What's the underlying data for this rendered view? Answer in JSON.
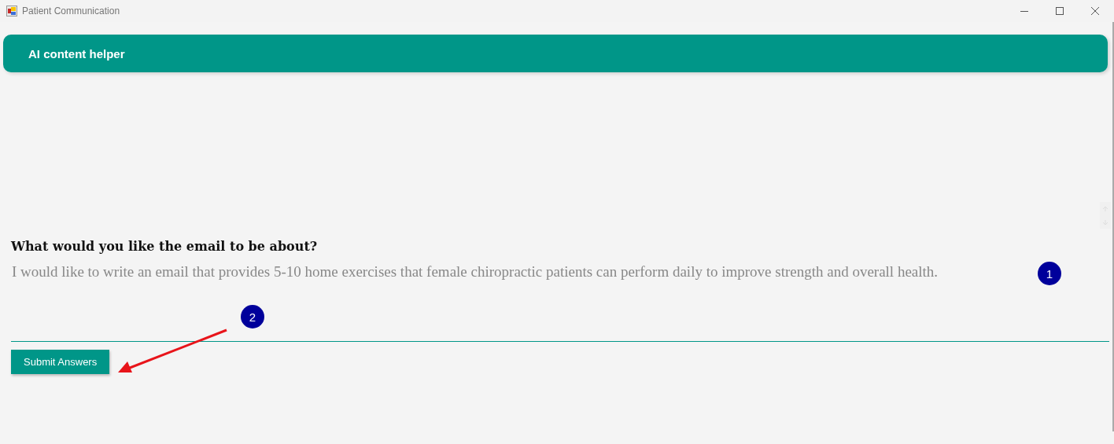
{
  "window": {
    "title": "Patient Communication"
  },
  "header": {
    "title": "AI content helper"
  },
  "question": {
    "label": "What would you like the email to be about?",
    "placeholder": "I would like to write an email that provides 5-10 home exercises that female chiropractic patients can perform daily to improve strength and overall health."
  },
  "submit_button": {
    "label": "Submit Answers"
  },
  "annotations": [
    {
      "number": "1"
    },
    {
      "number": "2"
    }
  ]
}
